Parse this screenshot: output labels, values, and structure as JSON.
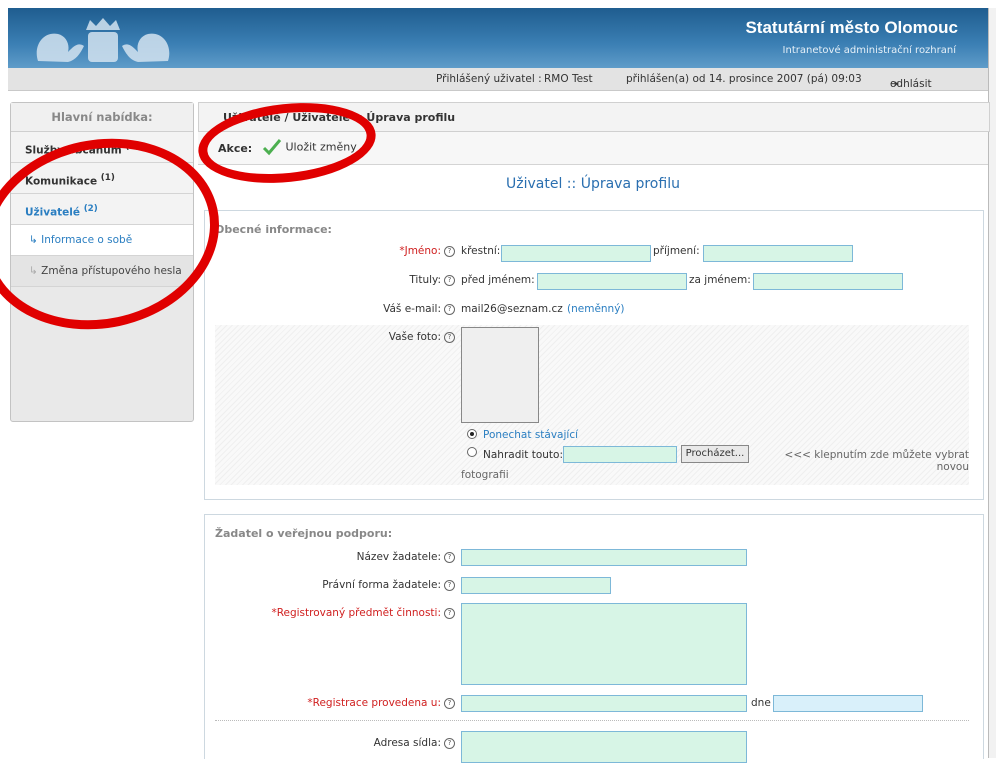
{
  "header": {
    "title": "Statutární město Olomouc",
    "subtitle": "Intranetové administrační rozhraní"
  },
  "userbar": {
    "user_label": "Přihlášený uživatel : ",
    "user_name": "RMO Test",
    "login_info": "přihlášen(a) od 14. prosince 2007 (pá) 09:03",
    "logout": "odhlásit"
  },
  "sidebar": {
    "heading": "Hlavní nabídka:",
    "items": [
      {
        "label": "Služby občanům",
        "badge": "(1)"
      },
      {
        "label": "Komunikace",
        "badge": "(1)"
      },
      {
        "label": "Uživatelé",
        "badge": "(2)"
      },
      {
        "label": "Informace o sobě"
      },
      {
        "label": "Změna přístupového hesla"
      }
    ]
  },
  "breadcrumb": "Uživatelé / Uživatelé :: Úprava profilu",
  "actions": {
    "label": "Akce:",
    "save": "Uložit změny"
  },
  "page_title": "Uživatel :: Úprava profilu",
  "general": {
    "legend": "Obecné informace:",
    "name_label": "Jméno:",
    "first_name": "křestní:",
    "last_name": "příjmení:",
    "titles_label": "Tituly:",
    "before_name": "před jménem:",
    "after_name": "za jménem:",
    "email_label": "Váš e-mail:",
    "email_value": "mail26@seznam.cz",
    "email_note": "(neměnný)",
    "photo_label": "Vaše foto:",
    "keep_option": "Ponechat stávající",
    "replace_option": "Nahradit touto:",
    "browse_button": "Procházet...",
    "photo_hint": "<<< klepnutím zde můžete vybrat novou",
    "photo_hint2": "fotografii"
  },
  "applicant": {
    "legend": "Žadatel o veřejnou podporu:",
    "name_label": "Název žadatele:",
    "legal_form_label": "Právní forma žadatele:",
    "activity_label": "Registrovaný předmět činnosti:",
    "registration_label": "Registrace provedena u:",
    "date_label": "dne",
    "address_label": "Adresa sídla:"
  },
  "colors": {
    "header": "#2f6fa5",
    "link": "#2a7ec1",
    "input_bg": "#d7f5e6",
    "required": "#d02020",
    "annotation": "#e00000"
  }
}
